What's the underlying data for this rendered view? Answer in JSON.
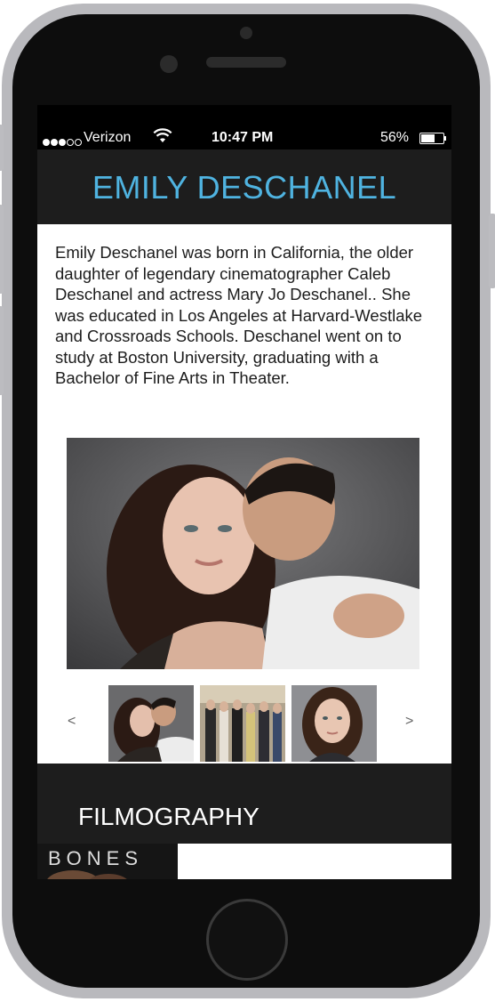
{
  "status_bar": {
    "carrier": "Verizon",
    "time": "10:47 PM",
    "battery": "56%",
    "signal_bars_filled": 3,
    "signal_bars_total": 5,
    "battery_level": 0.56
  },
  "header": {
    "title": "EMILY DESCHANEL"
  },
  "bio": {
    "text": "Emily Deschanel was born in California, the older daughter of legendary cinematographer Caleb Deschanel and actress Mary Jo Deschanel.. She was educated in Los Angeles at Harvard-Westlake and Crossroads Schools. Deschanel went on to study at Boston University, graduating with a Bachelor of Fine Arts in Theater."
  },
  "gallery": {
    "prev": "<",
    "next": ">"
  },
  "filmography": {
    "title": "FILMOGRAPHY",
    "items": [
      {
        "label": "BONES"
      }
    ]
  },
  "colors": {
    "accent": "#4fb3e0",
    "header_bg": "#1d1d1d",
    "phone_frame": "#b9b9bd"
  }
}
